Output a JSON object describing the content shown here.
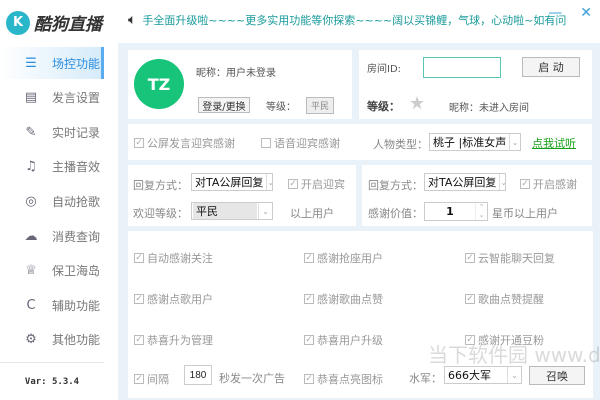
{
  "app": {
    "title": "酷狗直播",
    "logo_letter": "K"
  },
  "marquee": "手全面升级啦~~~~更多实用功能等你探索~~~~阔以买锦鲤，气球，心动啦~如有问",
  "window": {
    "minimize": "—",
    "close": "✕"
  },
  "sidebar": {
    "items": [
      {
        "label": "场控功能",
        "icon": "list-icon",
        "glyph": "☰",
        "active": true
      },
      {
        "label": "发言设置",
        "icon": "document-icon",
        "glyph": "▤"
      },
      {
        "label": "实时记录",
        "icon": "edit-icon",
        "glyph": "✎"
      },
      {
        "label": "主播音效",
        "icon": "music-icon",
        "glyph": "♫"
      },
      {
        "label": "自动抢歌",
        "icon": "location-icon",
        "glyph": "◎"
      },
      {
        "label": "消费查询",
        "icon": "cloud-upload-icon",
        "glyph": "☁"
      },
      {
        "label": "保卫海岛",
        "icon": "crown-icon",
        "glyph": "♕"
      },
      {
        "label": "辅助功能",
        "icon": "refresh-icon",
        "glyph": "C"
      },
      {
        "label": "其他功能",
        "icon": "gear-icon",
        "glyph": "⚙"
      }
    ],
    "version": "Var: 5.3.4"
  },
  "user": {
    "avatar_text": "TZ",
    "nickname_label": "昵称：用户未登录",
    "login_button": "登录/更换",
    "level_label": "等级：",
    "level_value": "平民"
  },
  "room": {
    "id_label": "房间ID:",
    "id_value": "",
    "start_button": "启 动",
    "level_label": "等级：",
    "nickname_label": "昵称：未进入房间"
  },
  "voice": {
    "public_welcome": "公屏发言迎宾感谢",
    "public_welcome_checked": true,
    "voice_welcome": "语音迎宾感谢",
    "voice_welcome_checked": false,
    "role_label": "人物类型：",
    "role_value": "桃子 |标准女声",
    "try_link": "点我试听"
  },
  "welcome": {
    "reply_label": "回复方式：",
    "reply_value": "对TA公屏回复",
    "enable": "开启迎宾",
    "level_label": "欢迎等级：",
    "level_value": "平民",
    "suffix": "以上用户"
  },
  "thanks": {
    "reply_label": "回复方式：",
    "reply_value": "对TA公屏回复",
    "enable": "开启感谢",
    "value_label": "感谢价值：",
    "value": "1",
    "suffix": "星币以上用户"
  },
  "options": [
    [
      "自动感谢关注",
      "感谢抢座用户",
      "云智能聊天回复"
    ],
    [
      "感谢点歌用户",
      "感谢歌曲点赞",
      "歌曲点赞提醒"
    ],
    [
      "恭喜升为管理",
      "恭喜用户升级",
      "感谢开通豆粉"
    ]
  ],
  "ad": {
    "label": "间隔",
    "interval": "180",
    "suffix": "秒发一次广告",
    "celebrate_icon": "恭喜点亮图标",
    "army_label": "水军：",
    "army_value": "666大军",
    "summon_button": "召唤"
  },
  "watermark": "当下软件园 www.downxia.com"
}
